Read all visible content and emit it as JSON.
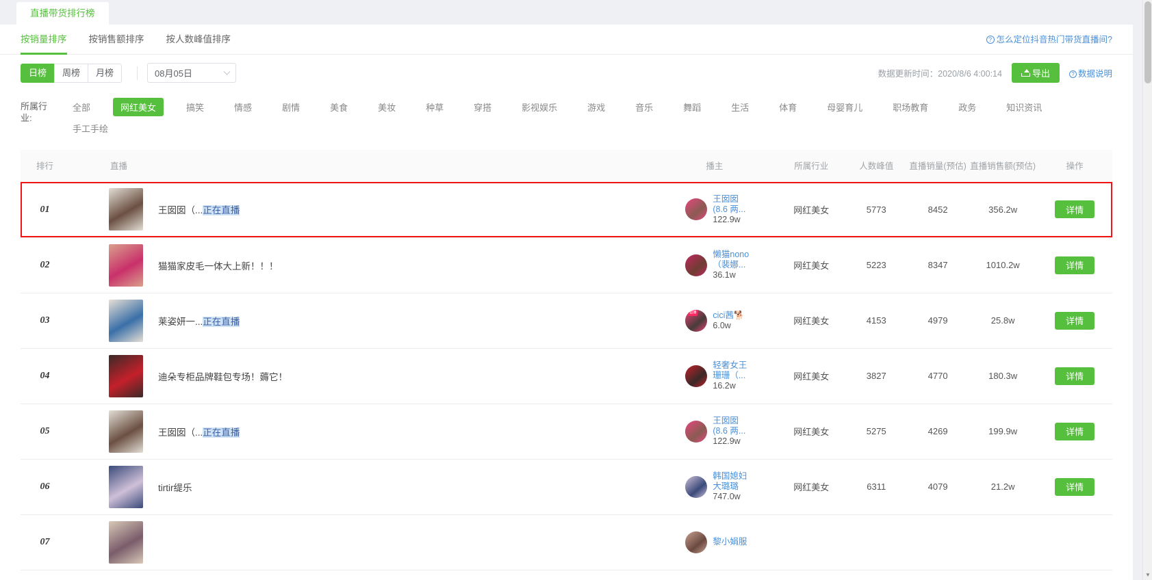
{
  "tab": {
    "label": "直播带货排行榜"
  },
  "sort_tabs": [
    {
      "label": "按销量排序",
      "active": true
    },
    {
      "label": "按销售额排序",
      "active": false
    },
    {
      "label": "按人数峰值排序",
      "active": false
    }
  ],
  "help_link": {
    "icon": "question-circle-icon",
    "label": "怎么定位抖音热门带货直播间?"
  },
  "period": [
    {
      "label": "日榜",
      "active": true
    },
    {
      "label": "周榜",
      "active": false
    },
    {
      "label": "月榜",
      "active": false
    }
  ],
  "date_select": {
    "value": "08月05日",
    "icon": "chevron-down-icon"
  },
  "update_time": "数据更新时间：2020/8/6 4:00:14",
  "export_button": {
    "label": "导出",
    "icon": "upload-icon"
  },
  "data_note": {
    "icon": "question-circle-icon",
    "label": "数据说明"
  },
  "industry": {
    "label": "所属行业:",
    "items": [
      {
        "label": "全部",
        "active": false
      },
      {
        "label": "网红美女",
        "active": true
      },
      {
        "label": "搞笑",
        "active": false
      },
      {
        "label": "情感",
        "active": false
      },
      {
        "label": "剧情",
        "active": false
      },
      {
        "label": "美食",
        "active": false
      },
      {
        "label": "美妆",
        "active": false
      },
      {
        "label": "种草",
        "active": false
      },
      {
        "label": "穿搭",
        "active": false
      },
      {
        "label": "影视娱乐",
        "active": false
      },
      {
        "label": "游戏",
        "active": false
      },
      {
        "label": "音乐",
        "active": false
      },
      {
        "label": "舞蹈",
        "active": false
      },
      {
        "label": "生活",
        "active": false
      },
      {
        "label": "体育",
        "active": false
      },
      {
        "label": "母婴育儿",
        "active": false
      },
      {
        "label": "职场教育",
        "active": false
      },
      {
        "label": "政务",
        "active": false
      },
      {
        "label": "知识资讯",
        "active": false
      },
      {
        "label": "手工手绘",
        "active": false
      }
    ]
  },
  "table": {
    "headers": {
      "rank": "排行",
      "live": "直播",
      "host": "播主",
      "industry": "所属行业",
      "peak": "人数峰值",
      "sales": "直播销量(预估)",
      "amount": "直播销售额(预估)",
      "operation": "操作"
    },
    "detail_label": "详情",
    "rows": [
      {
        "rank": "01",
        "title_main": "王囡囡（...",
        "title_live": "正在直播",
        "host_name": "王囡囡",
        "host_sub": "(8.6 两...",
        "host_fans": "122.9w",
        "industry": "网红美女",
        "peak": "5773",
        "sales": "8452",
        "amount": "356.2w",
        "highlighted": true,
        "live_badge": false,
        "thumb_c1": "#6b5042",
        "thumb_c2": "#e3ded6",
        "avatar_c1": "#e8467f",
        "avatar_c2": "#8a5b52"
      },
      {
        "rank": "02",
        "title_main": "猫猫家皮毛一体大上新！！！",
        "title_live": "",
        "host_name": "懒猫nono",
        "host_sub": "（裴娜...",
        "host_fans": "36.1w",
        "industry": "网红美女",
        "peak": "5223",
        "sales": "8347",
        "amount": "1010.2w",
        "highlighted": false,
        "live_badge": false,
        "thumb_c1": "#c9306a",
        "thumb_c2": "#d9a08c",
        "avatar_c1": "#c2285f",
        "avatar_c2": "#6f3c33"
      },
      {
        "rank": "03",
        "title_main": "莱姿妍一...",
        "title_live": "正在直播",
        "host_name": "cici茜🐕",
        "host_sub": "",
        "host_fans": "6.0w",
        "industry": "网红美女",
        "peak": "4153",
        "sales": "4979",
        "amount": "25.8w",
        "highlighted": false,
        "live_badge": true,
        "badge_text": "直播",
        "thumb_c1": "#3a6fa8",
        "thumb_c2": "#e6dfd4",
        "avatar_c1": "#f23f7a",
        "avatar_c2": "#463c38"
      },
      {
        "rank": "04",
        "title_main": "迪朵专柜品牌鞋包专场！薅它！",
        "title_live": "",
        "host_name": "轻奢女王",
        "host_sub": "珊珊（...",
        "host_fans": "16.2w",
        "industry": "网红美女",
        "peak": "3827",
        "sales": "4770",
        "amount": "180.3w",
        "highlighted": false,
        "live_badge": false,
        "thumb_c1": "#c4202a",
        "thumb_c2": "#3a2a28",
        "avatar_c1": "#c4202a",
        "avatar_c2": "#3a2a28"
      },
      {
        "rank": "05",
        "title_main": "王囡囡（...",
        "title_live": "正在直播",
        "host_name": "王囡囡",
        "host_sub": "(8.6 两...",
        "host_fans": "122.9w",
        "industry": "网红美女",
        "peak": "5275",
        "sales": "4269",
        "amount": "199.9w",
        "highlighted": false,
        "live_badge": false,
        "thumb_c1": "#6b5042",
        "thumb_c2": "#e3ded6",
        "avatar_c1": "#e8467f",
        "avatar_c2": "#8a5b52"
      },
      {
        "rank": "06",
        "title_main": "tirtir缇乐",
        "title_live": "",
        "host_name": "韩国媳妇",
        "host_sub": "大璐璐",
        "host_fans": "747.0w",
        "industry": "网红美女",
        "peak": "6311",
        "sales": "4079",
        "amount": "21.2w",
        "highlighted": false,
        "live_badge": false,
        "thumb_c1": "#cfc0d8",
        "thumb_c2": "#3a4a7a",
        "avatar_c1": "#cfc0d8",
        "avatar_c2": "#3a4a7a"
      },
      {
        "rank": "07",
        "title_main": "",
        "title_live": "",
        "host_name": "黎小娟服",
        "host_sub": "",
        "host_fans": "",
        "industry": "",
        "peak": "",
        "sales": "",
        "amount": "",
        "highlighted": false,
        "live_badge": false,
        "thumb_c1": "#7a5c6a",
        "thumb_c2": "#d8c9b8",
        "avatar_c1": "#c8a090",
        "avatar_c2": "#6a4a40"
      }
    ]
  },
  "colors": {
    "accent_green": "#57bf3e",
    "link_blue": "#4a90d9",
    "highlight_red": "#f01414"
  }
}
